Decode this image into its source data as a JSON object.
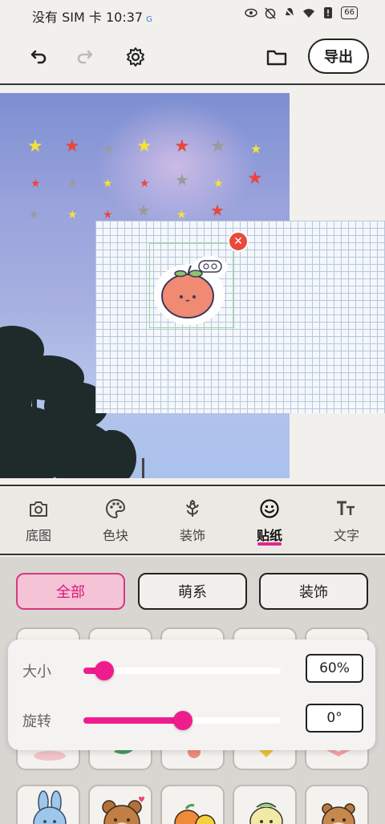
{
  "status_bar": {
    "carrier": "没有 SIM 卡",
    "time": "10:37",
    "g_badge": "G",
    "battery": "66"
  },
  "toolbar": {
    "export_label": "导出"
  },
  "tabs": [
    {
      "label": "底图",
      "icon": "camera-icon"
    },
    {
      "label": "色块",
      "icon": "palette-icon"
    },
    {
      "label": "装饰",
      "icon": "flower-icon"
    },
    {
      "label": "贴纸",
      "icon": "smiley-icon",
      "active": true
    },
    {
      "label": "文字",
      "icon": "text-size-icon"
    }
  ],
  "filters": [
    {
      "label": "全部",
      "active": true
    },
    {
      "label": "萌系",
      "active": false
    },
    {
      "label": "装饰",
      "active": false
    }
  ],
  "sliders": {
    "size": {
      "label": "大小",
      "value_text": "60%",
      "value": 0.1
    },
    "rotation": {
      "label": "旋转",
      "value_text": "0°",
      "value": 0.5
    }
  },
  "colors": {
    "accent": "#ef1c8e",
    "star_yellow": "#f4e13a",
    "star_red": "#e8463f",
    "star_gray": "#9a9a9a"
  }
}
